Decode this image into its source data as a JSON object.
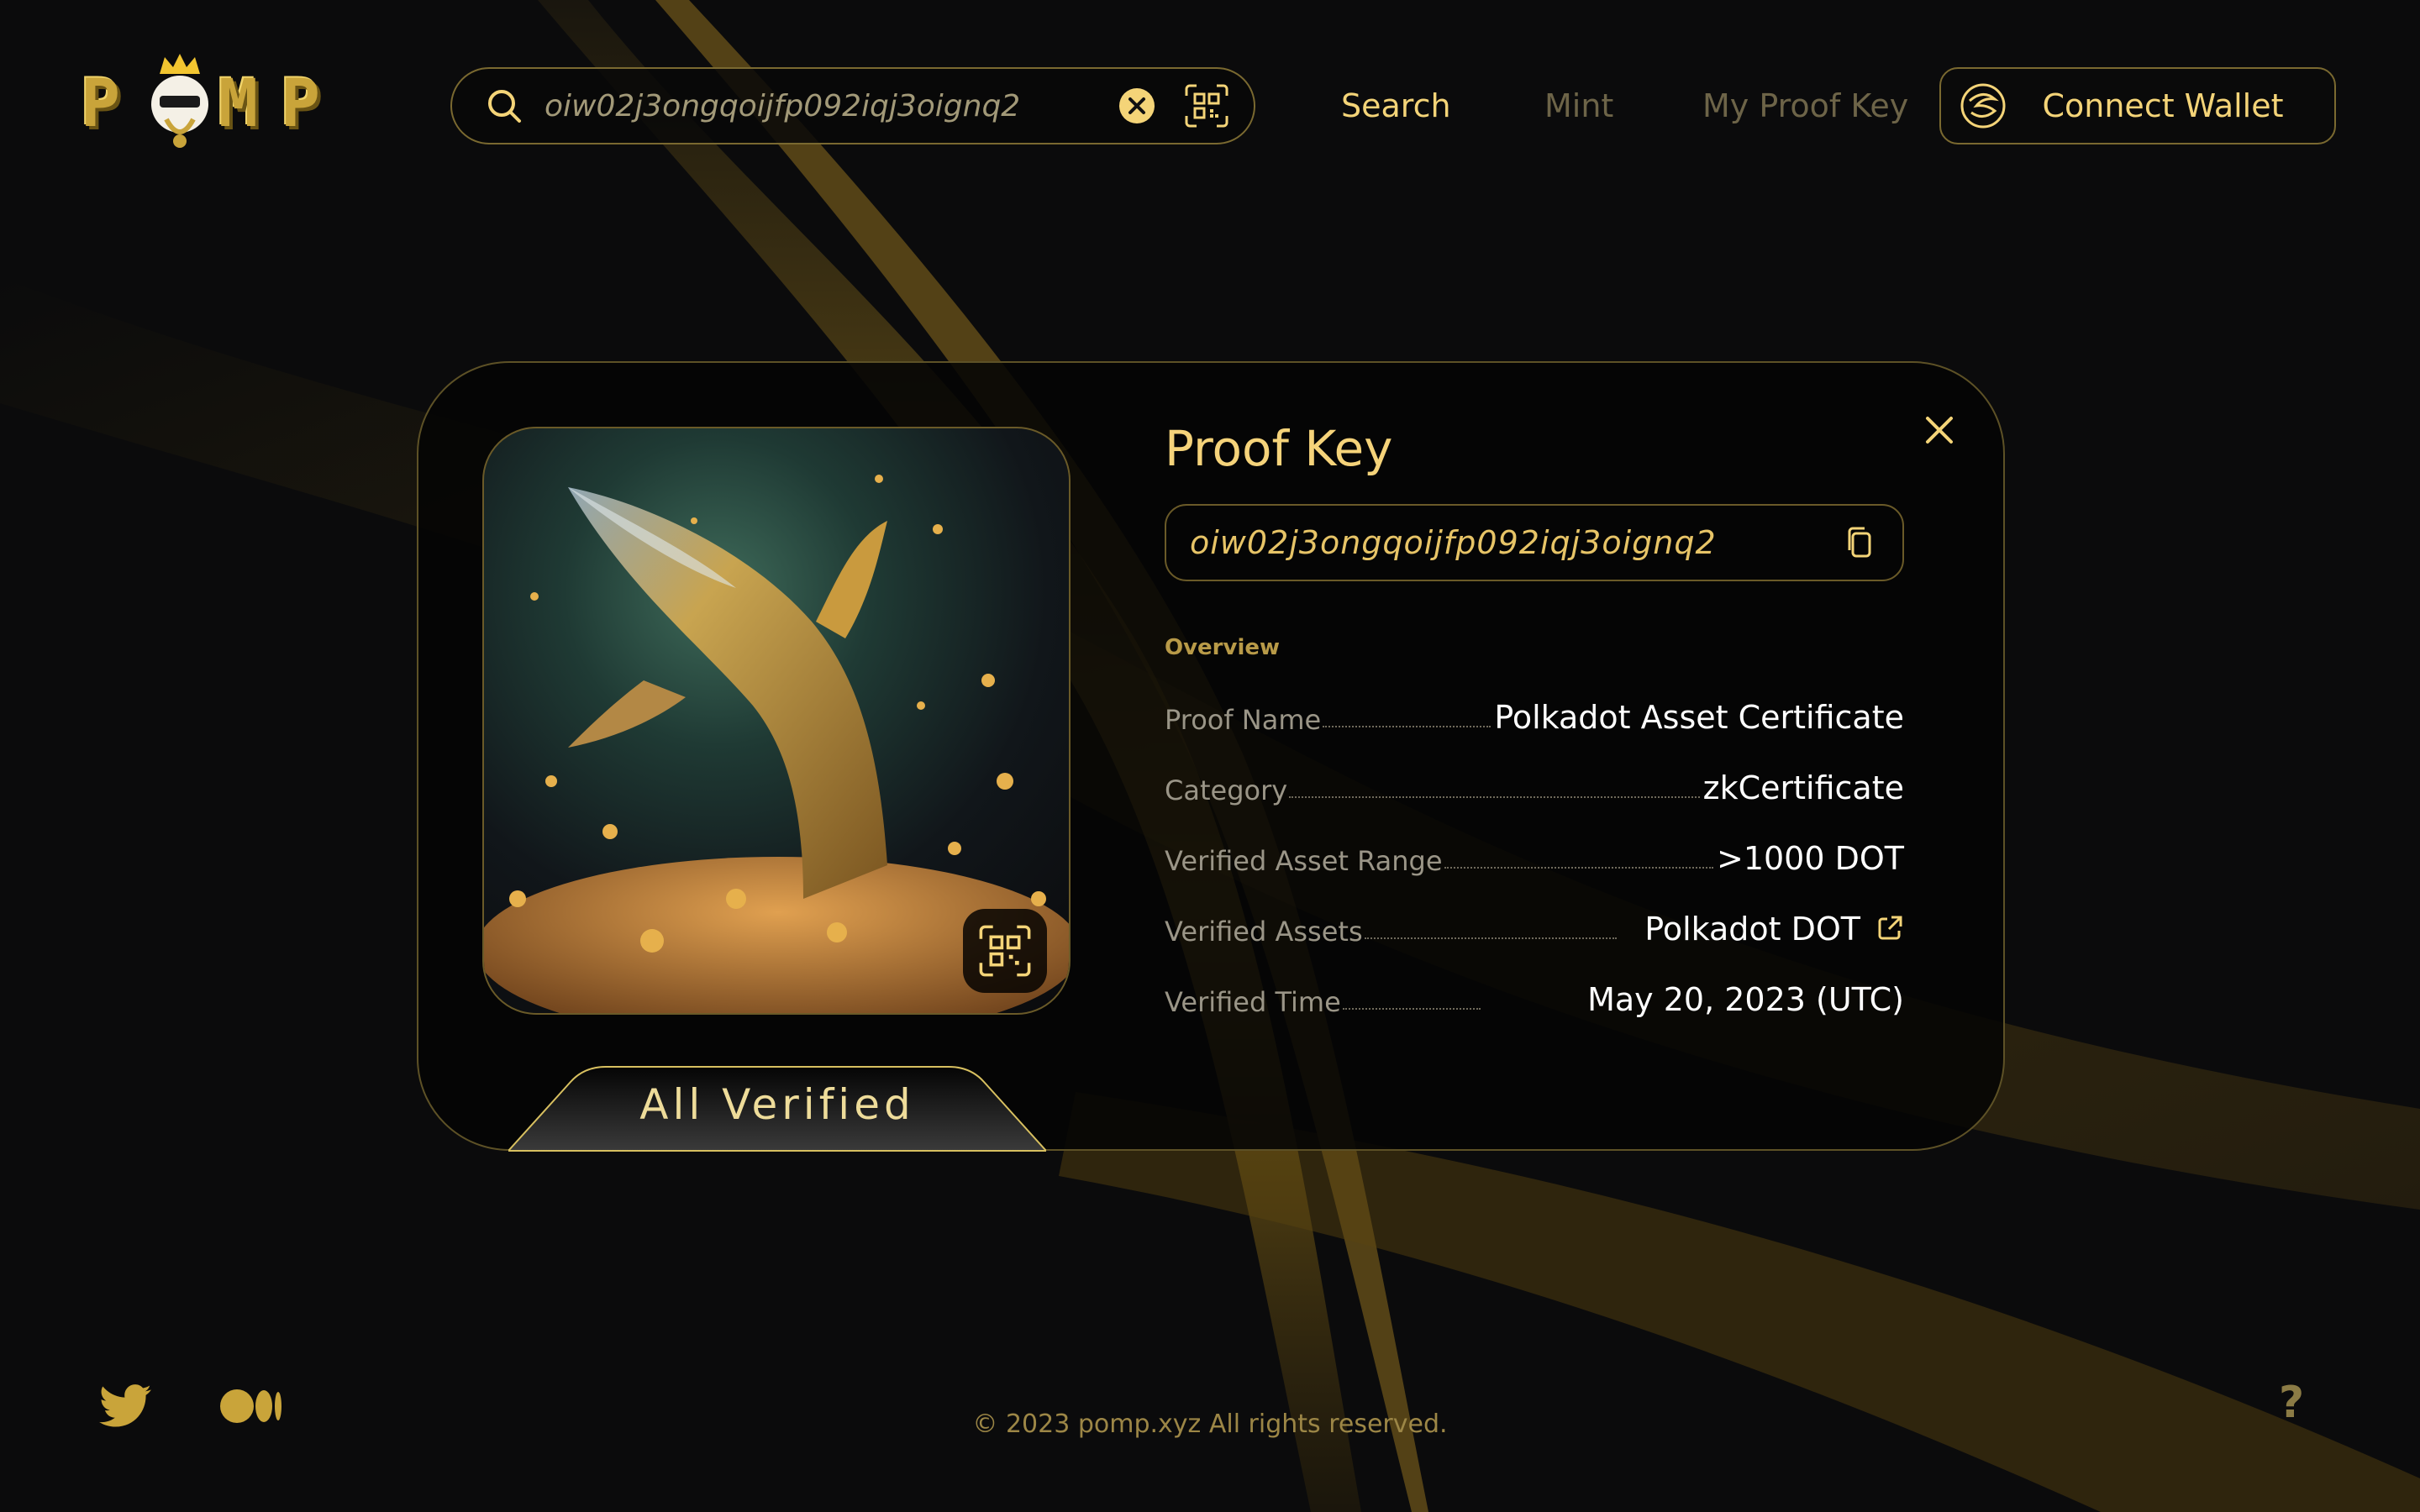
{
  "brand": {
    "logo_text": "POMP"
  },
  "search": {
    "value": "oiw02j3ongqoijfp092iqj3oignq2",
    "placeholder": ""
  },
  "nav": {
    "search_label": "Search",
    "mint_label": "Mint",
    "my_proof_key_label": "My Proof Key",
    "active": "Search"
  },
  "wallet": {
    "connect_label": "Connect Wallet"
  },
  "proof_card": {
    "title": "Proof Key",
    "key": "oiw02j3ongqoijfp092iqj3oignq2",
    "status_label": "All Verified",
    "overview_label": "Overview",
    "rows": [
      {
        "label": "Proof Name",
        "value": "Polkadot Asset Certificate"
      },
      {
        "label": "Category",
        "value": "zkCertificate"
      },
      {
        "label": "Verified Asset Range",
        "value": ">1000 DOT"
      },
      {
        "label": "Verified Assets",
        "value": "Polkadot DOT"
      },
      {
        "label": "Verified Time",
        "value": "May 20, 2023 (UTC)"
      }
    ]
  },
  "footer": {
    "copyright": "© 2023 pomp.xyz All rights reserved.",
    "help_label": "?"
  },
  "icons": {
    "search": "search-icon",
    "clear": "clear-icon",
    "qr": "qr-code-icon",
    "wallet": "wallet-swirl-icon",
    "close": "close-icon",
    "copy": "copy-icon",
    "external": "external-link-icon",
    "twitter": "twitter-icon",
    "medium": "medium-icon"
  },
  "colors": {
    "accent": "#f4d478",
    "gold": "#c9a43a",
    "background": "#0b0b0c",
    "text_white": "#ffffff"
  }
}
